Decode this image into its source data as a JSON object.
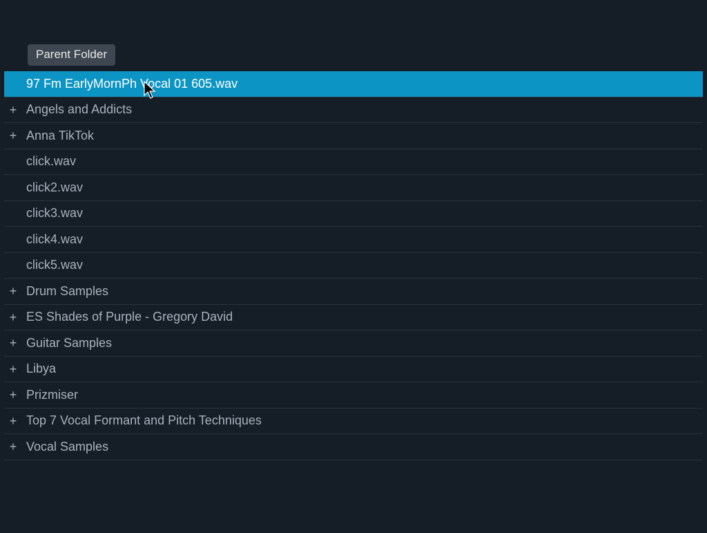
{
  "parent_folder_label": "Parent Folder",
  "plus_glyph": "+",
  "items": [
    {
      "label": "97 Fm EarlyMornPh Vocal 01 605.wav",
      "is_folder": false,
      "selected": true
    },
    {
      "label": "Angels and Addicts",
      "is_folder": true,
      "selected": false
    },
    {
      "label": "Anna TikTok",
      "is_folder": true,
      "selected": false
    },
    {
      "label": "click.wav",
      "is_folder": false,
      "selected": false
    },
    {
      "label": "click2.wav",
      "is_folder": false,
      "selected": false
    },
    {
      "label": "click3.wav",
      "is_folder": false,
      "selected": false
    },
    {
      "label": "click4.wav",
      "is_folder": false,
      "selected": false
    },
    {
      "label": "click5.wav",
      "is_folder": false,
      "selected": false
    },
    {
      "label": "Drum Samples",
      "is_folder": true,
      "selected": false
    },
    {
      "label": "ES Shades of Purple - Gregory David",
      "is_folder": true,
      "selected": false
    },
    {
      "label": "Guitar Samples",
      "is_folder": true,
      "selected": false
    },
    {
      "label": "Libya",
      "is_folder": true,
      "selected": false
    },
    {
      "label": "Prizmiser",
      "is_folder": true,
      "selected": false
    },
    {
      "label": "Top 7 Vocal Formant and Pitch Techniques",
      "is_folder": true,
      "selected": false
    },
    {
      "label": "Vocal Samples",
      "is_folder": true,
      "selected": false
    }
  ]
}
